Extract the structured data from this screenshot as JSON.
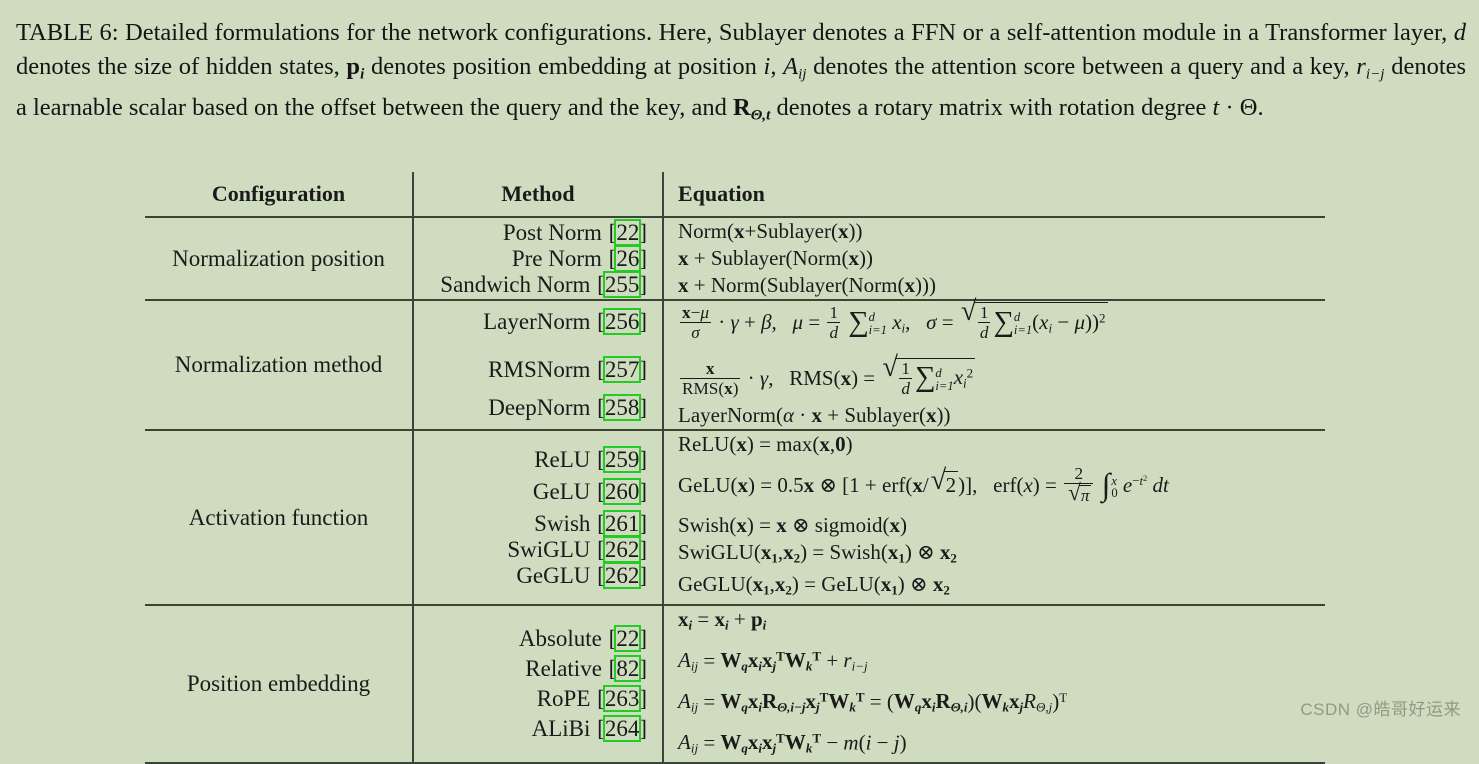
{
  "caption": {
    "label": "TABLE 6:",
    "text_full": "TABLE 6: Detailed formulations for the network configurations. Here, Sublayer denotes a FFN or a self-attention module in a Transformer layer, d denotes the size of hidden states, p_i denotes position embedding at position i, A_ij denotes the attention score between a query and a key, r_{i-j} denotes a learnable scalar based on the offset between the query and the key, and R_{Θ,t} denotes a rotary matrix with rotation degree t · Θ.",
    "seg1": "Detailed formulations for the network configurations. Here, Sublayer denotes a FFN or a self-attention module in a Transformer layer,",
    "seg2": "denotes the size of hidden states,",
    "seg3": "denotes position embedding at position",
    "seg4": "denotes the attention score between a query and a key,",
    "seg5": "denotes a learnable scalar based on the offset between the query and the",
    "seg6": "key, and",
    "seg7": "denotes a rotary matrix with rotation degree"
  },
  "table": {
    "headers": {
      "configuration": "Configuration",
      "method": "Method",
      "equation": "Equation"
    },
    "sections": [
      {
        "configuration": "Normalization position",
        "rows": [
          {
            "method": "Post Norm",
            "citation": "22",
            "equation": "Norm(x+Sublayer(x))"
          },
          {
            "method": "Pre Norm",
            "citation": "26",
            "equation": "x + Sublayer(Norm(x))"
          },
          {
            "method": "Sandwich Norm",
            "citation": "255",
            "equation": "x + Norm(Sublayer(Norm(x)))"
          }
        ]
      },
      {
        "configuration": "Normalization method",
        "rows": [
          {
            "method": "LayerNorm",
            "citation": "256",
            "equation": "(x-μ)/σ · γ + β,  μ = 1/d Σ_{i=1}^{d} x_i,  σ = sqrt( 1/d Σ_{i=1}^{d} (x_i - μ))^2"
          },
          {
            "method": "RMSNorm",
            "citation": "257",
            "equation": "x/RMS(x) · γ,  RMS(x) = sqrt( 1/d Σ_{i=1}^{d} x_i^2 )"
          },
          {
            "method": "DeepNorm",
            "citation": "258",
            "equation": "LayerNorm(α · x + Sublayer(x))"
          }
        ]
      },
      {
        "configuration": "Activation function",
        "rows": [
          {
            "method": "ReLU",
            "citation": "259",
            "equation": "ReLU(x) = max(x, 0)"
          },
          {
            "method": "GeLU",
            "citation": "260",
            "equation": "GeLU(x) = 0.5x ⊗ [1 + erf(x/√2)],  erf(x) = 2/√π ∫_0^x e^{-t^2} dt"
          },
          {
            "method": "Swish",
            "citation": "261",
            "equation": "Swish(x) = x ⊗ sigmoid(x)"
          },
          {
            "method": "SwiGLU",
            "citation": "262",
            "equation": "SwiGLU(x1, x2) = Swish(x1) ⊗ x2"
          },
          {
            "method": "GeGLU",
            "citation": "262",
            "equation": "GeGLU(x1, x2) = GeLU(x1) ⊗ x2"
          }
        ]
      },
      {
        "configuration": "Position embedding",
        "rows": [
          {
            "method": "Absolute",
            "citation": "22",
            "equation": "x_i = x_i + p_i"
          },
          {
            "method": "Relative",
            "citation": "82",
            "equation": "A_ij = W_q x_i x_j^T W_k^T + r_{i-j}"
          },
          {
            "method": "RoPE",
            "citation": "263",
            "equation": "A_ij = W_q x_i R_{Θ,i-j} x_j^T W_k^T = (W_q x_i R_{Θ,i})(W_k x_j R_{Θ,j})^T"
          },
          {
            "method": "ALiBi",
            "citation": "264",
            "equation": "A_ij = W_q x_i x_j^T W_k^T - m(i - j)"
          }
        ]
      }
    ]
  },
  "watermark": {
    "text": "CSDN @皓哥好运来"
  },
  "colors": {
    "background": "#cfdcc0",
    "text": "#1a1a1a",
    "rule": "#3a453a",
    "citation_highlight": "#22cc22",
    "watermark": "#8f9c84"
  }
}
